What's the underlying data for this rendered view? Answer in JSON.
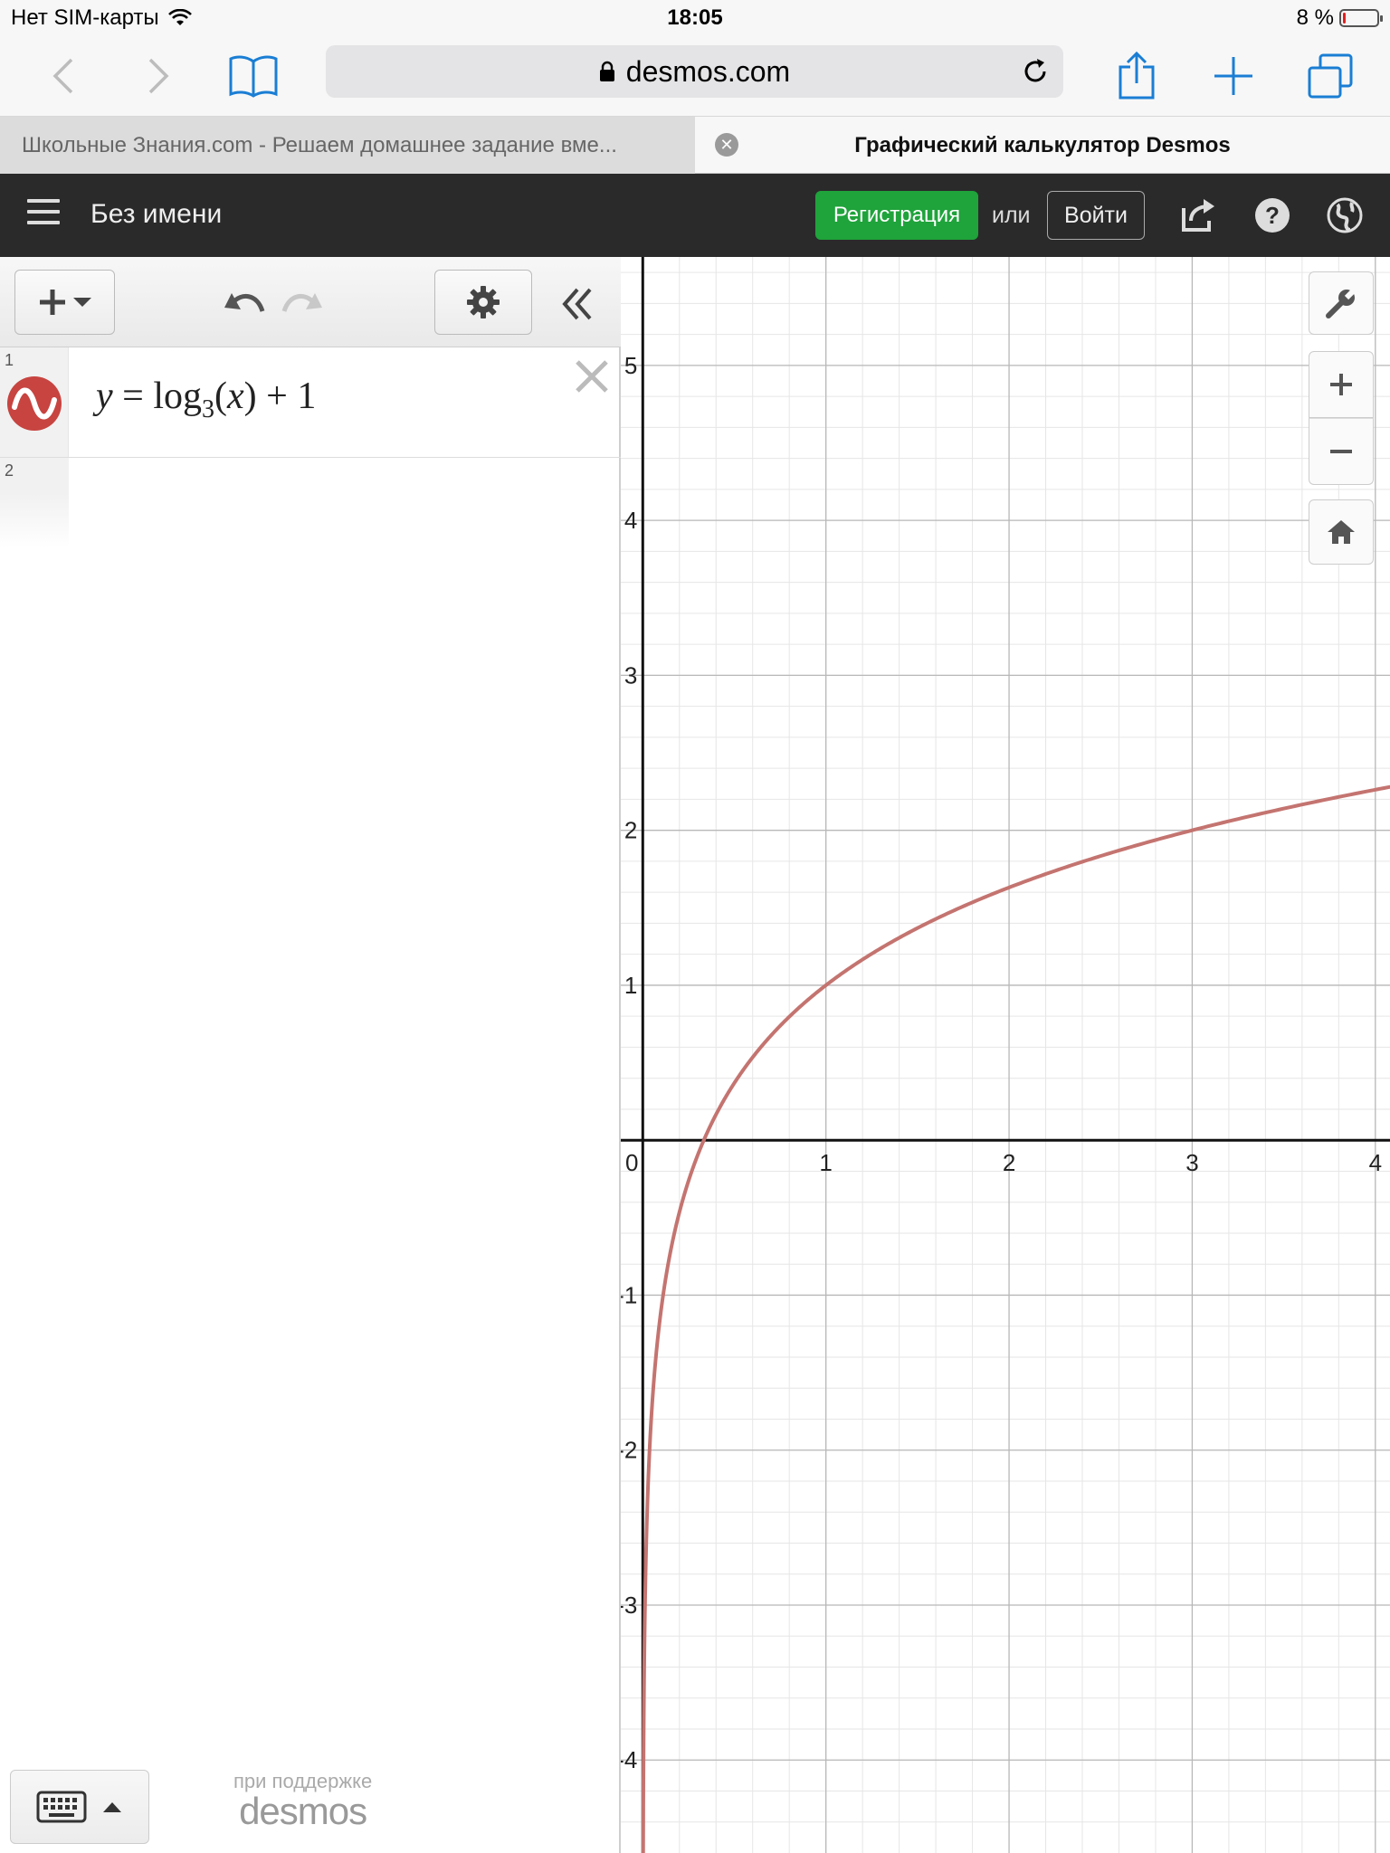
{
  "status_bar": {
    "carrier": "Нет SIM-карты",
    "time": "18:05",
    "battery": "8 %",
    "battery_level": 0.08
  },
  "browser": {
    "url": "desmos.com",
    "tabs": [
      {
        "label": "Школьные Знания.com - Решаем домашнее задание вме..."
      },
      {
        "label": "Графический калькулятор Desmos"
      }
    ]
  },
  "desmos_header": {
    "title": "Без имени",
    "signup_label": "Регистрация",
    "or_label": "или",
    "login_label": "Войти"
  },
  "expressions": [
    {
      "number": "1",
      "color": "#c74440",
      "latex_parts": {
        "y": "y",
        "eq": "=",
        "fn": "log",
        "base": "3",
        "open": "(",
        "arg": "x",
        "close": ")",
        "plus": "+",
        "const": "1"
      }
    },
    {
      "number": "2"
    }
  ],
  "footer": {
    "powered_label": "при поддержке",
    "logo_text": "desmos"
  },
  "icons": {
    "back": "chevron-left-icon",
    "forward": "chevron-right-icon",
    "bookmarks": "book-icon",
    "share": "share-icon",
    "new_tab": "plus-icon",
    "tabs": "tabs-icon"
  },
  "colors": {
    "curve": "#c47470",
    "signup": "#1fa33b",
    "header_bg": "#2a2a2a",
    "ios_blue": "#1a7ed4"
  },
  "chart_data": {
    "type": "line",
    "series": [
      {
        "expression": "y = log3(x) + 1",
        "function": "log3(x)+1"
      }
    ],
    "xlim": [
      -0.12,
      4.08
    ],
    "ylim": [
      -4.6,
      5.7
    ],
    "x_ticks": [
      "0",
      "1",
      "2",
      "3",
      "4"
    ],
    "y_ticks": [
      "-4",
      "-3",
      "-2",
      "-1",
      "1",
      "2",
      "3",
      "4",
      "5"
    ],
    "grid": true,
    "minor_per_major": 5
  }
}
